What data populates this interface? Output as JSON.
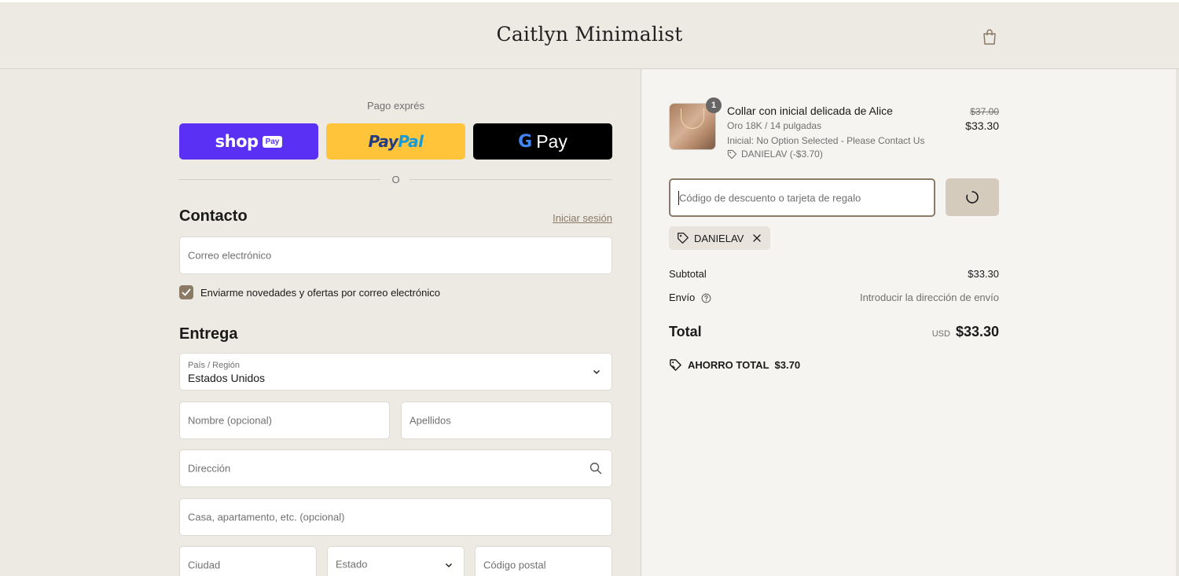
{
  "header": {
    "store_name": "Caitlyn Minimalist",
    "cart_icon": "shopping-bag-icon"
  },
  "express": {
    "title": "Pago exprés",
    "shop_pay_label": "shop",
    "shop_pay_badge": "Pay",
    "paypal_label_1": "Pay",
    "paypal_label_2": "Pal",
    "gpay_g": "G",
    "gpay_label": "Pay",
    "divider_text": "O"
  },
  "contact": {
    "title": "Contacto",
    "login_link": "Iniciar sesión",
    "email_placeholder": "Correo electrónico",
    "newsletter_label": "Enviarme novedades y ofertas por correo electrónico",
    "newsletter_checked": true
  },
  "delivery": {
    "title": "Entrega",
    "country_label": "País / Región",
    "country_value": "Estados Unidos",
    "first_name_placeholder": "Nombre (opcional)",
    "last_name_placeholder": "Apellidos",
    "address_placeholder": "Dirección",
    "apartment_placeholder": "Casa, apartamento, etc. (opcional)",
    "city_placeholder": "Ciudad",
    "state_placeholder": "Estado",
    "zip_placeholder": "Código postal"
  },
  "order": {
    "item": {
      "quantity": "1",
      "name": "Collar con inicial delicada de Alice",
      "variant": "Oro 18K / 14 pulgadas",
      "option": "Inicial: No Option Selected - Please Contact Us",
      "discount": "DANIELAV (-$3.70)",
      "price_original": "$37.00",
      "price_current": "$33.30"
    },
    "discount_placeholder": "Código de descuento o tarjeta de regalo",
    "applied_code": "DANIELAV",
    "subtotal_label": "Subtotal",
    "subtotal_value": "$33.30",
    "shipping_label": "Envío",
    "shipping_value": "Introducir la dirección de envío",
    "total_label": "Total",
    "total_currency": "USD",
    "total_value": "$33.30",
    "savings_label": "AHORRO TOTAL",
    "savings_value": "$3.70"
  },
  "colors": {
    "accent": "#8a7a66",
    "shop_pay": "#5a31f4",
    "paypal": "#ffc439",
    "gpay": "#000000",
    "page_bg": "#ede9e3",
    "summary_bg": "#f6f4f1"
  }
}
